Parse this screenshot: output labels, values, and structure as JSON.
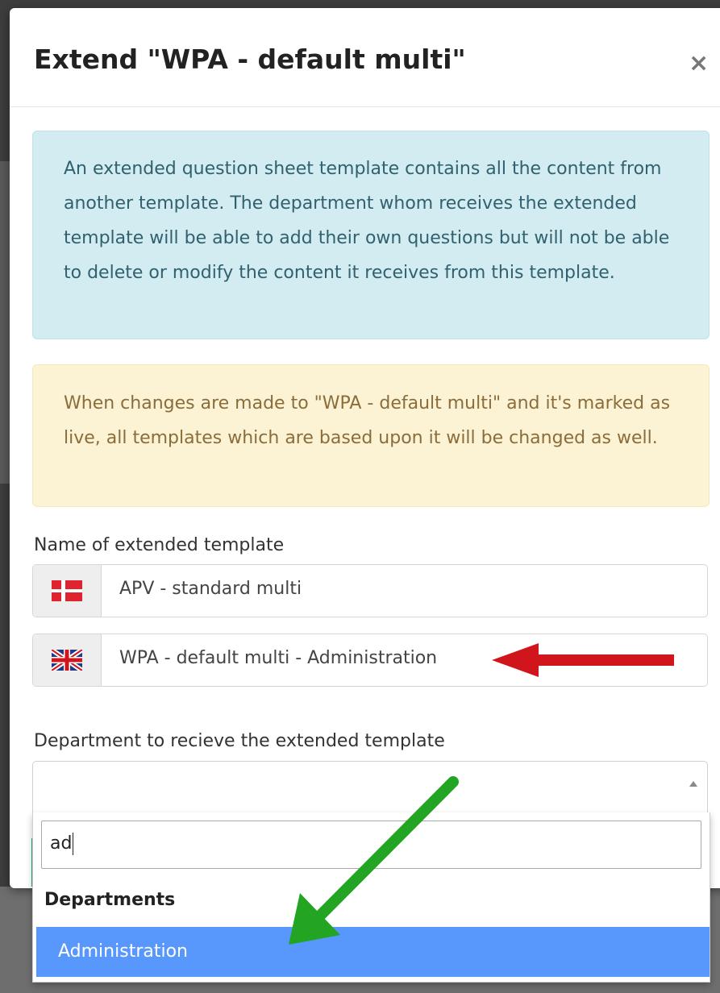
{
  "modal": {
    "title": "Extend \"WPA - default multi\"",
    "close_symbol": "×"
  },
  "info_alert": {
    "text": "An extended question sheet template contains all the content from another template. The department whom receives the extended template will be able to add their own questions but will not be able to delete or modify the content it receives from this template."
  },
  "warning_alert": {
    "text": "When changes are made to \"WPA - default multi\" and it's marked as live, all templates which are based upon it will be changed as well."
  },
  "name_field": {
    "label": "Name of extended template",
    "inputs": [
      {
        "language": "Danish",
        "flag_icon": "danish-flag-icon",
        "value": "APV - standard multi"
      },
      {
        "language": "English",
        "flag_icon": "uk-flag-icon",
        "value": "WPA - default multi - Administration"
      }
    ]
  },
  "department_field": {
    "label": "Department to recieve the extended template",
    "selected_value": "",
    "search_value": "ad",
    "group_label": "Departments",
    "options": [
      "Administration"
    ],
    "highlighted_option": "Administration"
  },
  "annotations": {
    "red_arrow_color": "#d0151c",
    "green_arrow_color": "#23a523"
  },
  "colors": {
    "info_bg": "#d2ecf1",
    "warning_bg": "#fcf2d4",
    "highlight": "#5897fb"
  }
}
